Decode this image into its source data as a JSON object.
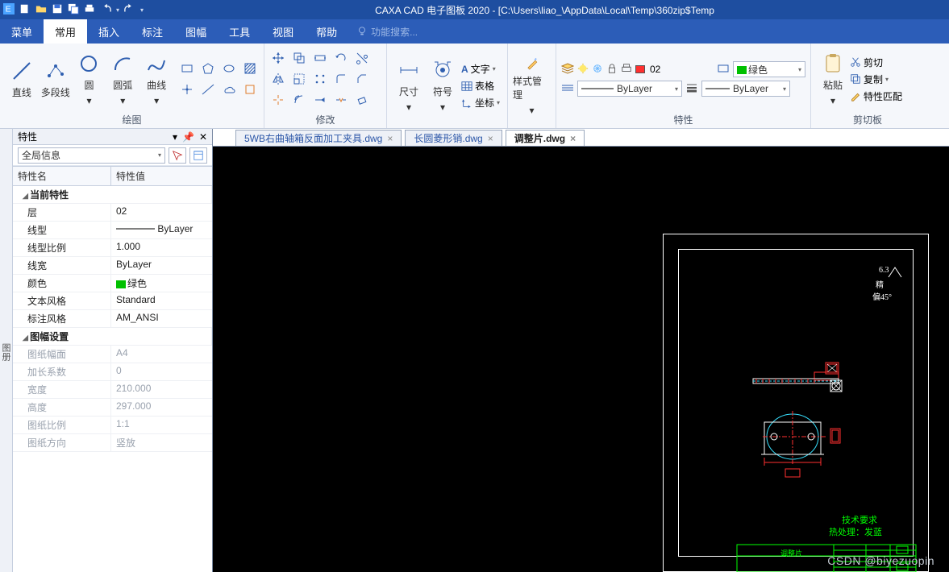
{
  "title": "CAXA CAD 电子图板 2020 - [C:\\Users\\liao_\\AppData\\Local\\Temp\\360zip$Temp",
  "menu": {
    "items": [
      "菜单",
      "常用",
      "插入",
      "标注",
      "图幅",
      "工具",
      "视图",
      "帮助"
    ],
    "active": 1,
    "search_placeholder": "功能搜索..."
  },
  "ribbon": {
    "draw": {
      "label": "绘图",
      "big": [
        "直线",
        "多段线",
        "圆",
        "圆弧",
        "曲线"
      ]
    },
    "modify": {
      "label": "修改"
    },
    "annotate": {
      "label": "",
      "items": [
        "尺寸",
        "符号"
      ],
      "sub": [
        "文字",
        "表格",
        "坐标"
      ]
    },
    "style": {
      "label": "",
      "btn": "样式管理"
    },
    "props": {
      "label": "特性",
      "layer_code": "02",
      "color_name": "绿色",
      "linetype": "ByLayer",
      "lineweight": "ByLayer"
    },
    "clip": {
      "label": "剪切板",
      "btn": "粘贴",
      "items": [
        "剪切",
        "复制",
        "特性匹配"
      ]
    }
  },
  "side_tab": "图册",
  "prop": {
    "title": "特性",
    "selector": "全局信息",
    "head": [
      "特性名",
      "特性值"
    ],
    "rows": [
      {
        "section": true,
        "name": "当前特性"
      },
      {
        "name": "层",
        "val": "02"
      },
      {
        "name": "线型",
        "val": "ByLayer",
        "line": true
      },
      {
        "name": "线型比例",
        "val": "1.000"
      },
      {
        "name": "线宽",
        "val": "ByLayer"
      },
      {
        "name": "颜色",
        "val": "绿色",
        "swatch": "#00c000"
      },
      {
        "name": "文本风格",
        "val": "Standard"
      },
      {
        "name": "标注风格",
        "val": "AM_ANSI"
      },
      {
        "section": true,
        "name": "图幅设置"
      },
      {
        "name": "图纸幅面",
        "val": "A4",
        "disabled": true
      },
      {
        "name": "加长系数",
        "val": "0",
        "disabled": true
      },
      {
        "name": "宽度",
        "val": "210.000",
        "disabled": true
      },
      {
        "name": "高度",
        "val": "297.000",
        "disabled": true
      },
      {
        "name": "图纸比例",
        "val": "1:1",
        "disabled": true
      },
      {
        "name": "图纸方向",
        "val": "竖放",
        "disabled": true
      }
    ]
  },
  "tabs": [
    {
      "label": "5WB右曲轴箱反面加工夹具.dwg",
      "active": false
    },
    {
      "label": "长圆菱形销.dwg",
      "active": false
    },
    {
      "label": "调整片.dwg",
      "active": true
    }
  ],
  "drawing": {
    "annot_top": "6.3",
    "annot_mid": "精",
    "annot_angle": "偏45°",
    "tech_title": "技术要求",
    "tech_line": "热处理：发蓝",
    "titleblock_name": "调整片"
  },
  "watermark": "CSDN @biyezuopin"
}
